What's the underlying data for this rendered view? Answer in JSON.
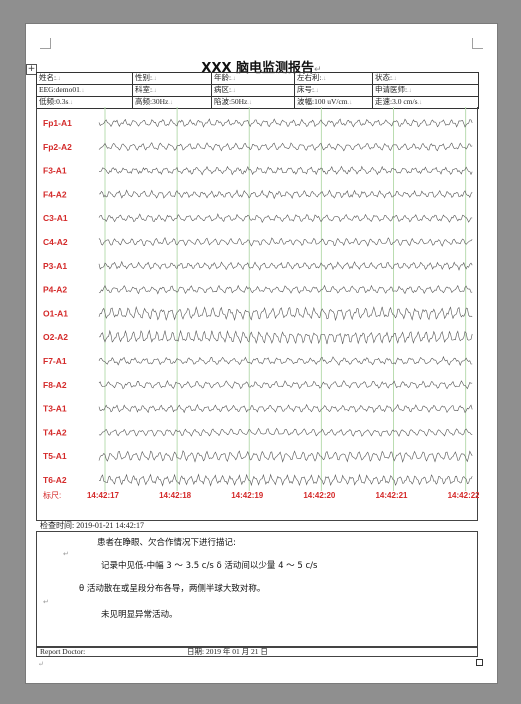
{
  "report": {
    "title": "XXX 脑电监测报告",
    "para_mark": "↵"
  },
  "info_rows": [
    [
      "姓名:",
      "性别:",
      "年龄:",
      "左右利:",
      "状态:"
    ],
    [
      "EEG:demo01",
      "科室:",
      "病区:",
      "床号:",
      "申请医师:"
    ],
    [
      "低频:0.3s",
      "高频:30Hz",
      "陷波:50Hz",
      "波幅:100 uV/cm",
      "走速:3.0 cm/s"
    ]
  ],
  "channels": [
    "Fp1-A1",
    "Fp2-A2",
    "F3-A1",
    "F4-A2",
    "C3-A1",
    "C4-A2",
    "P3-A1",
    "P4-A2",
    "O1-A1",
    "O2-A2",
    "F7-A1",
    "F8-A2",
    "T3-A1",
    "T4-A2",
    "T5-A1",
    "T6-A2"
  ],
  "scale_label": "标尺:",
  "timestamps": [
    "14:42:17",
    "14:42:18",
    "14:42:19",
    "14:42:20",
    "14:42:21",
    "14:42:22"
  ],
  "colors": {
    "channel_label": "#d42a2a",
    "trace": "#555555",
    "grid": "#b9dcb0"
  },
  "exam_time": "检查时间: 2019-01-21 14:42:17",
  "notes": {
    "line1": "患者在睁眼、欠合作情况下进行描记:",
    "line2": "记录中见低-中幅 3 ～ 3.5 c/s  δ 活动间以少量 4 ～ 5 c/s",
    "line3": "θ 活动散在或呈段分布各导，两侧半球大致对称。",
    "line4": "未见明显异常活动。"
  },
  "footer": {
    "doctor_label": "Report Doctor:",
    "date_label": "日期: 2019 年 01 月 21 日"
  }
}
